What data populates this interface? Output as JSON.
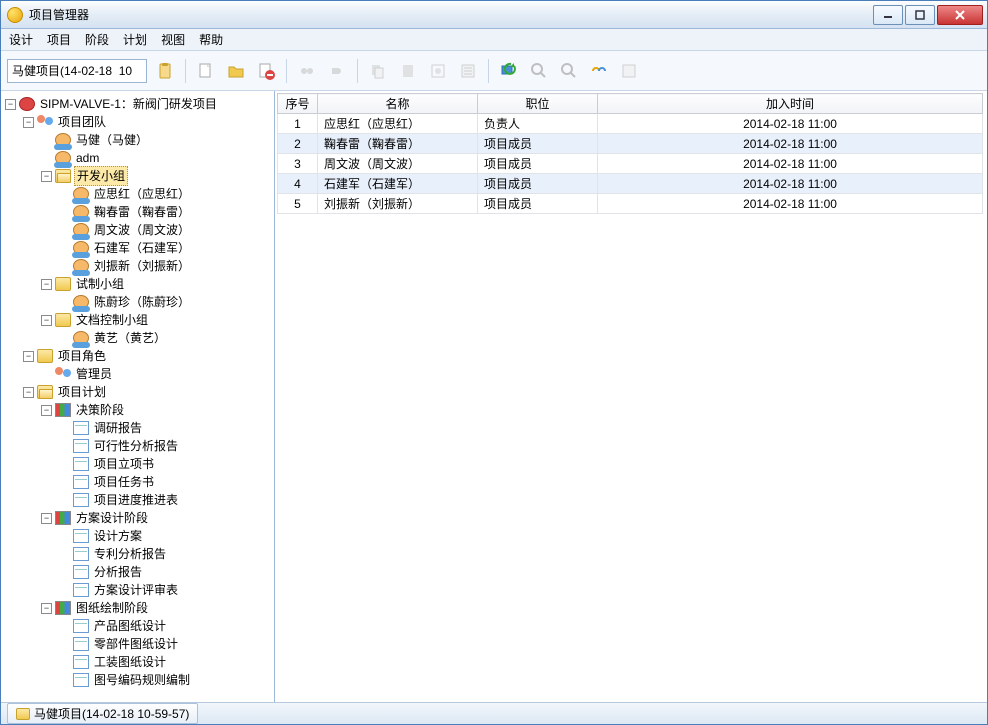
{
  "window": {
    "title": "项目管理器"
  },
  "menu": [
    "设计",
    "项目",
    "阶段",
    "计划",
    "视图",
    "帮助"
  ],
  "toolbar": {
    "project_input": "马健项目(14-02-18  10"
  },
  "tree": {
    "root": "SIPM-VALVE-1：新阀门研发项目",
    "team": "项目团队",
    "person1": "马健（马健）",
    "person2": "adm",
    "group_dev": "开发小组",
    "dev1": "应思红（应思红）",
    "dev2": "鞠春雷（鞠春雷）",
    "dev3": "周文波（周文波）",
    "dev4": "石建军（石建军）",
    "dev5": "刘振新（刘振新）",
    "group_trial": "试制小组",
    "trial1": "陈蔚珍（陈蔚珍）",
    "group_doc": "文档控制小组",
    "doc1": "黄艺（黄艺）",
    "roles": "项目角色",
    "role_admin": "管理员",
    "plan": "项目计划",
    "phase1": "决策阶段",
    "p1d1": "调研报告",
    "p1d2": "可行性分析报告",
    "p1d3": "项目立项书",
    "p1d4": "项目任务书",
    "p1d5": "项目进度推进表",
    "phase2": "方案设计阶段",
    "p2d1": "设计方案",
    "p2d2": "专利分析报告",
    "p2d3": "分析报告",
    "p2d4": "方案设计评审表",
    "phase3": "图纸绘制阶段",
    "p3d1": "产品图纸设计",
    "p3d2": "零部件图纸设计",
    "p3d3": "工装图纸设计",
    "p3d4": "图号编码规则编制"
  },
  "table": {
    "headers": {
      "seq": "序号",
      "name": "名称",
      "pos": "职位",
      "time": "加入时间"
    },
    "rows": [
      {
        "seq": "1",
        "name": "应思红（应思红）",
        "pos": "负责人",
        "time": "2014-02-18 11:00"
      },
      {
        "seq": "2",
        "name": "鞠春雷（鞠春雷）",
        "pos": "项目成员",
        "time": "2014-02-18 11:00"
      },
      {
        "seq": "3",
        "name": "周文波（周文波）",
        "pos": "项目成员",
        "time": "2014-02-18 11:00"
      },
      {
        "seq": "4",
        "name": "石建军（石建军）",
        "pos": "项目成员",
        "time": "2014-02-18 11:00"
      },
      {
        "seq": "5",
        "name": "刘振新（刘振新）",
        "pos": "项目成员",
        "time": "2014-02-18 11:00"
      }
    ]
  },
  "status": {
    "tab": "马健项目(14-02-18  10-59-57)"
  }
}
